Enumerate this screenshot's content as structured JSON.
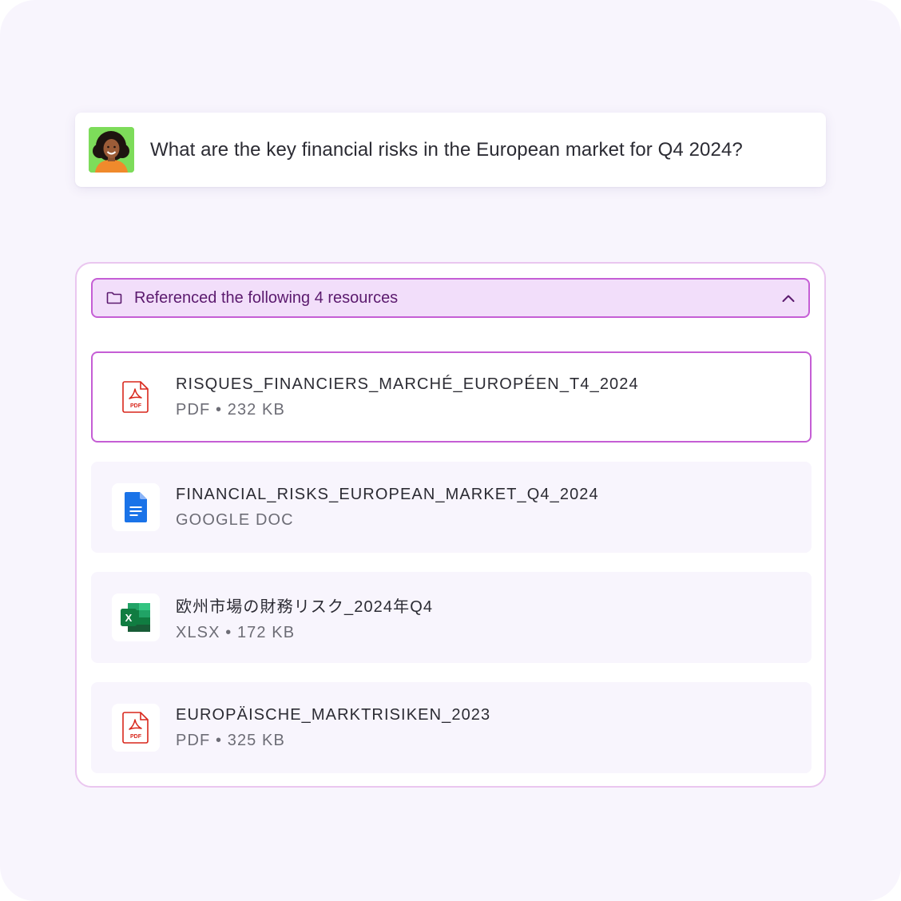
{
  "prompt": {
    "avatar": "user-avatar",
    "text": "What are the key financial risks in the European market for Q4 2024?"
  },
  "resources": {
    "header_label": "Referenced the following 4 resources",
    "header_icon": "folder-icon",
    "collapse_icon": "chevron-up-icon",
    "accent_color": "#c55ed5",
    "files": [
      {
        "name": "RISQUES_FINANCIERS_MARCHÉ_EUROPÉEN_T4_2024",
        "meta": "PDF • 232 KB",
        "icon": "pdf-icon",
        "selected": true
      },
      {
        "name": "FINANCIAL_RISKS_EUROPEAN_MARKET_Q4_2024",
        "meta": "GOOGLE DOC",
        "icon": "google-doc-icon",
        "selected": false
      },
      {
        "name": "欧州市場の財務リスク_2024年Q4",
        "meta": "XLSX • 172 KB",
        "icon": "excel-icon",
        "selected": false
      },
      {
        "name": "EUROPÄISCHE_MARKTRISIKEN_2023",
        "meta": "PDF • 325 KB",
        "icon": "pdf-icon",
        "selected": false
      }
    ]
  }
}
